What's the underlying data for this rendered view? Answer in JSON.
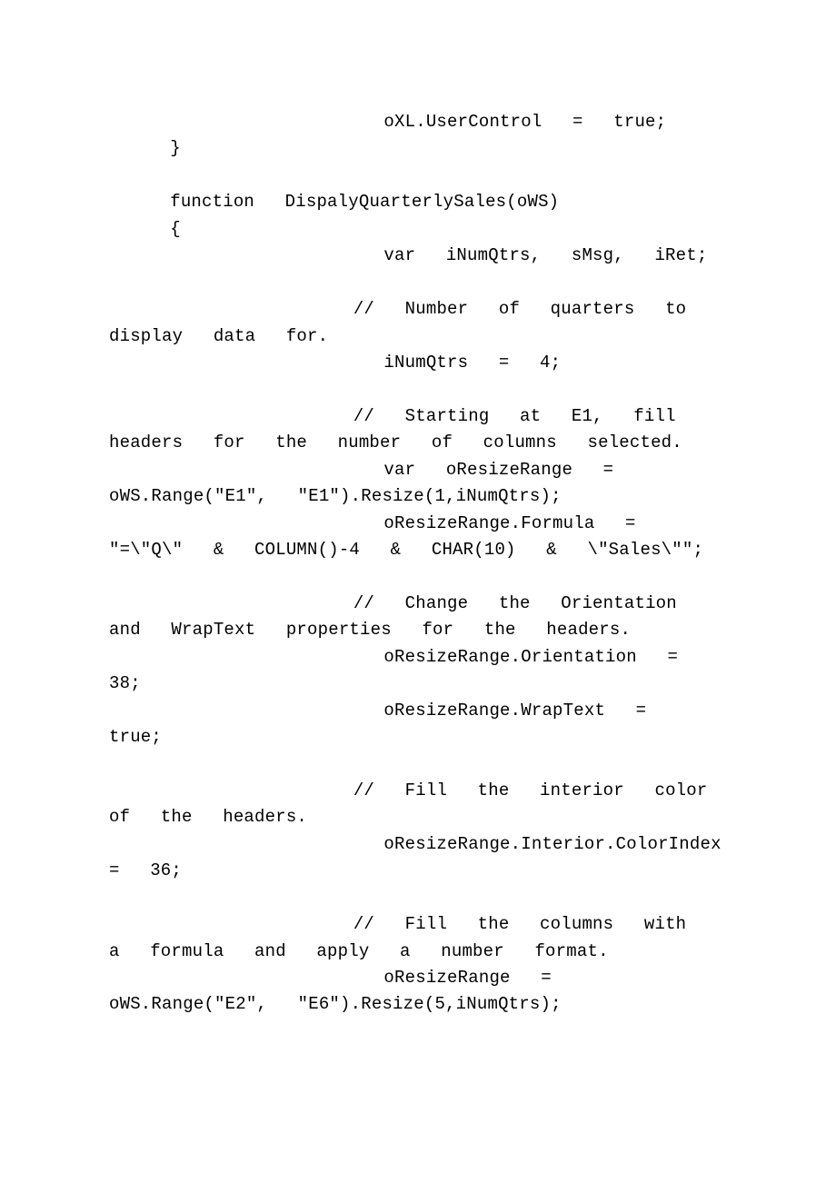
{
  "code": {
    "line01": "         oXL.UserControl = true;",
    "line02": "  }",
    "line03": "",
    "line04": "  function DispalyQuarterlySales(oWS)",
    "line05": "  {",
    "line06": "         var iNumQtrs, sMsg, iRet;",
    "line07": "",
    "line08": "        // Number of quarters to display data for.",
    "line09": "         iNumQtrs = 4;",
    "line10": "",
    "line11": "        // Starting at E1, fill headers for the number of columns selected.",
    "line12": "         var oResizeRange = oWS.Range(\"E1\", \"E1\").Resize(1,iNumQtrs);",
    "line13": "         oResizeRange.Formula = \"=\\\"Q\\\" & COLUMN()-4 & CHAR(10) & \\\"Sales\\\"\";",
    "line14": "",
    "line15": "        // Change the Orientation and WrapText properties for the headers.",
    "line16": "         oResizeRange.Orientation = 38;",
    "line17": "         oResizeRange.WrapText = true;",
    "line18": "",
    "line19": "        // Fill the interior color of the headers.",
    "line20": "         oResizeRange.Interior.ColorIndex = 36;",
    "line21": "",
    "line22": "        // Fill the columns with a formula and apply a number format.",
    "line23": "         oResizeRange = oWS.Range(\"E2\", \"E6\").Resize(5,iNumQtrs);"
  }
}
